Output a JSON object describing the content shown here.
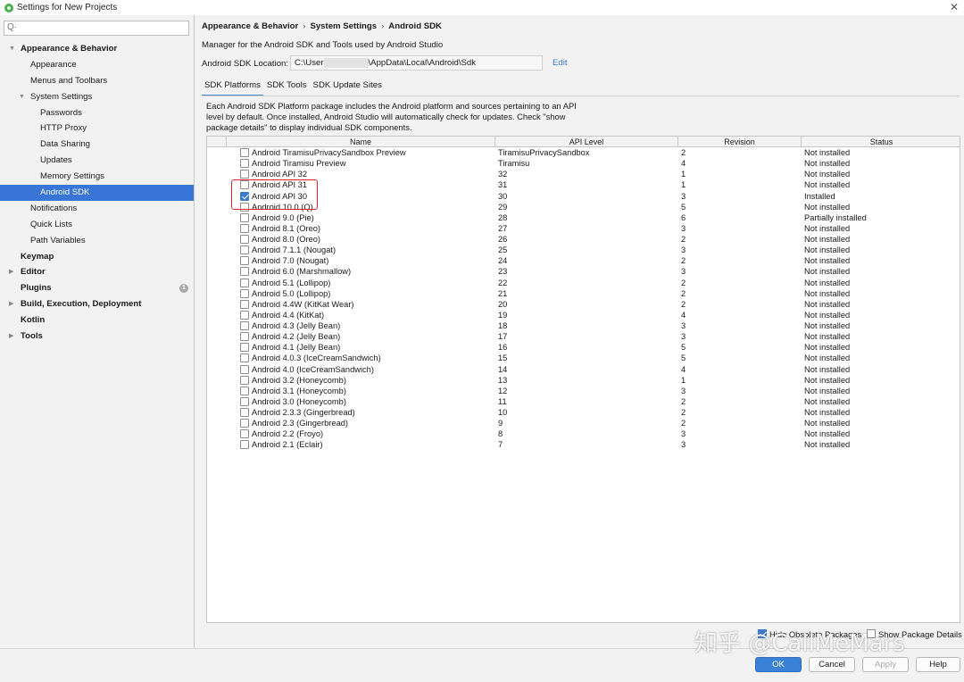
{
  "window": {
    "title": "Settings for New Projects"
  },
  "search": {
    "placeholder": ""
  },
  "sidebar": {
    "items": [
      {
        "label": "Appearance & Behavior",
        "bold": true,
        "indent": 0,
        "arrow": "down"
      },
      {
        "label": "Appearance",
        "bold": false,
        "indent": 1,
        "arrow": ""
      },
      {
        "label": "Menus and Toolbars",
        "bold": false,
        "indent": 1,
        "arrow": ""
      },
      {
        "label": "System Settings",
        "bold": false,
        "indent": 1,
        "arrow": "down"
      },
      {
        "label": "Passwords",
        "bold": false,
        "indent": 2,
        "arrow": ""
      },
      {
        "label": "HTTP Proxy",
        "bold": false,
        "indent": 2,
        "arrow": ""
      },
      {
        "label": "Data Sharing",
        "bold": false,
        "indent": 2,
        "arrow": ""
      },
      {
        "label": "Updates",
        "bold": false,
        "indent": 2,
        "arrow": ""
      },
      {
        "label": "Memory Settings",
        "bold": false,
        "indent": 2,
        "arrow": ""
      },
      {
        "label": "Android SDK",
        "bold": false,
        "indent": 2,
        "arrow": "",
        "selected": true
      },
      {
        "label": "Notifications",
        "bold": false,
        "indent": 1,
        "arrow": ""
      },
      {
        "label": "Quick Lists",
        "bold": false,
        "indent": 1,
        "arrow": ""
      },
      {
        "label": "Path Variables",
        "bold": false,
        "indent": 1,
        "arrow": ""
      },
      {
        "label": "Keymap",
        "bold": true,
        "indent": 0,
        "arrow": ""
      },
      {
        "label": "Editor",
        "bold": true,
        "indent": 0,
        "arrow": "right"
      },
      {
        "label": "Plugins",
        "bold": true,
        "indent": 0,
        "arrow": "",
        "badge": "1"
      },
      {
        "label": "Build, Execution, Deployment",
        "bold": true,
        "indent": 0,
        "arrow": "right"
      },
      {
        "label": "Kotlin",
        "bold": true,
        "indent": 0,
        "arrow": ""
      },
      {
        "label": "Tools",
        "bold": true,
        "indent": 0,
        "arrow": "right"
      }
    ]
  },
  "breadcrumb": {
    "items": [
      "Appearance & Behavior",
      "System Settings",
      "Android SDK"
    ],
    "separator": "›"
  },
  "main": {
    "description": "Manager for the Android SDK and Tools used by Android Studio",
    "location_label": "Android SDK Location:",
    "location_prefix": "C:\\User",
    "location_suffix": "\\AppData\\Local\\Android\\Sdk",
    "edit_label": "Edit",
    "tabs": [
      "SDK Platforms",
      "SDK Tools",
      "SDK Update Sites"
    ],
    "info_text": "Each Android SDK Platform package includes the Android platform and sources pertaining to an API level by default. Once installed, Android Studio will automatically check for updates. Check \"show package details\" to display individual SDK components."
  },
  "table": {
    "columns": [
      "Name",
      "API Level",
      "Revision",
      "Status"
    ],
    "rows": [
      {
        "name": "Android TiramisuPrivacySandbox Preview",
        "api": "TiramisuPrivacySandbox",
        "rev": "2",
        "status": "Not installed",
        "checked": false
      },
      {
        "name": "Android Tiramisu Preview",
        "api": "Tiramisu",
        "rev": "4",
        "status": "Not installed",
        "checked": false
      },
      {
        "name": "Android API 32",
        "api": "32",
        "rev": "1",
        "status": "Not installed",
        "checked": false
      },
      {
        "name": "Android API 31",
        "api": "31",
        "rev": "1",
        "status": "Not installed",
        "checked": false
      },
      {
        "name": "Android API 30",
        "api": "30",
        "rev": "3",
        "status": "Installed",
        "checked": true
      },
      {
        "name": "Android 10.0 (Q)",
        "api": "29",
        "rev": "5",
        "status": "Not installed",
        "checked": false
      },
      {
        "name": "Android 9.0 (Pie)",
        "api": "28",
        "rev": "6",
        "status": "Partially installed",
        "checked": false
      },
      {
        "name": "Android 8.1 (Oreo)",
        "api": "27",
        "rev": "3",
        "status": "Not installed",
        "checked": false
      },
      {
        "name": "Android 8.0 (Oreo)",
        "api": "26",
        "rev": "2",
        "status": "Not installed",
        "checked": false
      },
      {
        "name": "Android 7.1.1 (Nougat)",
        "api": "25",
        "rev": "3",
        "status": "Not installed",
        "checked": false
      },
      {
        "name": "Android 7.0 (Nougat)",
        "api": "24",
        "rev": "2",
        "status": "Not installed",
        "checked": false
      },
      {
        "name": "Android 6.0 (Marshmallow)",
        "api": "23",
        "rev": "3",
        "status": "Not installed",
        "checked": false
      },
      {
        "name": "Android 5.1 (Lollipop)",
        "api": "22",
        "rev": "2",
        "status": "Not installed",
        "checked": false
      },
      {
        "name": "Android 5.0 (Lollipop)",
        "api": "21",
        "rev": "2",
        "status": "Not installed",
        "checked": false
      },
      {
        "name": "Android 4.4W (KitKat Wear)",
        "api": "20",
        "rev": "2",
        "status": "Not installed",
        "checked": false
      },
      {
        "name": "Android 4.4 (KitKat)",
        "api": "19",
        "rev": "4",
        "status": "Not installed",
        "checked": false
      },
      {
        "name": "Android 4.3 (Jelly Bean)",
        "api": "18",
        "rev": "3",
        "status": "Not installed",
        "checked": false
      },
      {
        "name": "Android 4.2 (Jelly Bean)",
        "api": "17",
        "rev": "3",
        "status": "Not installed",
        "checked": false
      },
      {
        "name": "Android 4.1 (Jelly Bean)",
        "api": "16",
        "rev": "5",
        "status": "Not installed",
        "checked": false
      },
      {
        "name": "Android 4.0.3 (IceCreamSandwich)",
        "api": "15",
        "rev": "5",
        "status": "Not installed",
        "checked": false
      },
      {
        "name": "Android 4.0 (IceCreamSandwich)",
        "api": "14",
        "rev": "4",
        "status": "Not installed",
        "checked": false
      },
      {
        "name": "Android 3.2 (Honeycomb)",
        "api": "13",
        "rev": "1",
        "status": "Not installed",
        "checked": false
      },
      {
        "name": "Android 3.1 (Honeycomb)",
        "api": "12",
        "rev": "3",
        "status": "Not installed",
        "checked": false
      },
      {
        "name": "Android 3.0 (Honeycomb)",
        "api": "11",
        "rev": "2",
        "status": "Not installed",
        "checked": false
      },
      {
        "name": "Android 2.3.3 (Gingerbread)",
        "api": "10",
        "rev": "2",
        "status": "Not installed",
        "checked": false
      },
      {
        "name": "Android 2.3 (Gingerbread)",
        "api": "9",
        "rev": "2",
        "status": "Not installed",
        "checked": false
      },
      {
        "name": "Android 2.2 (Froyo)",
        "api": "8",
        "rev": "3",
        "status": "Not installed",
        "checked": false
      },
      {
        "name": "Android 2.1 (Eclair)",
        "api": "7",
        "rev": "3",
        "status": "Not installed",
        "checked": false
      }
    ]
  },
  "options": {
    "hide_obsolete_label": "Hide Obsolete Packages",
    "hide_obsolete_checked": true,
    "show_details_label": "Show Package Details",
    "show_details_checked": false
  },
  "footer": {
    "ok_label": "OK",
    "cancel_label": "Cancel",
    "apply_label": "Apply",
    "help_label": "Help"
  },
  "watermark": {
    "text": "知乎 @CallMeMars"
  },
  "colors": {
    "selection": "#3875d7",
    "accent": "#3b82d6",
    "highlight_box": "#d9262b",
    "link": "#3a78c9"
  }
}
